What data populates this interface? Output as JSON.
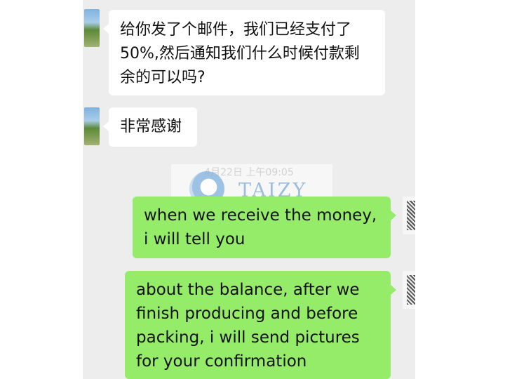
{
  "messages": [
    {
      "side": "left",
      "text": "给你发了个邮件，我们已经支付了50%,然后通知我们什么时候付款剩余的可以吗?"
    },
    {
      "side": "left",
      "text": "非常感谢"
    },
    {
      "side": "right",
      "text": "when we receive the money, i will tell you"
    },
    {
      "side": "right",
      "text": "about the balance, after we finish producing and before packing, i will send pictures for your confirmation"
    }
  ],
  "timestamp": "4月22日 上午09:05",
  "watermark": {
    "text": "TAIZY"
  },
  "colors": {
    "chat_bg": "#ededed",
    "incoming_bubble": "#ffffff",
    "outgoing_bubble": "#95ec69"
  }
}
